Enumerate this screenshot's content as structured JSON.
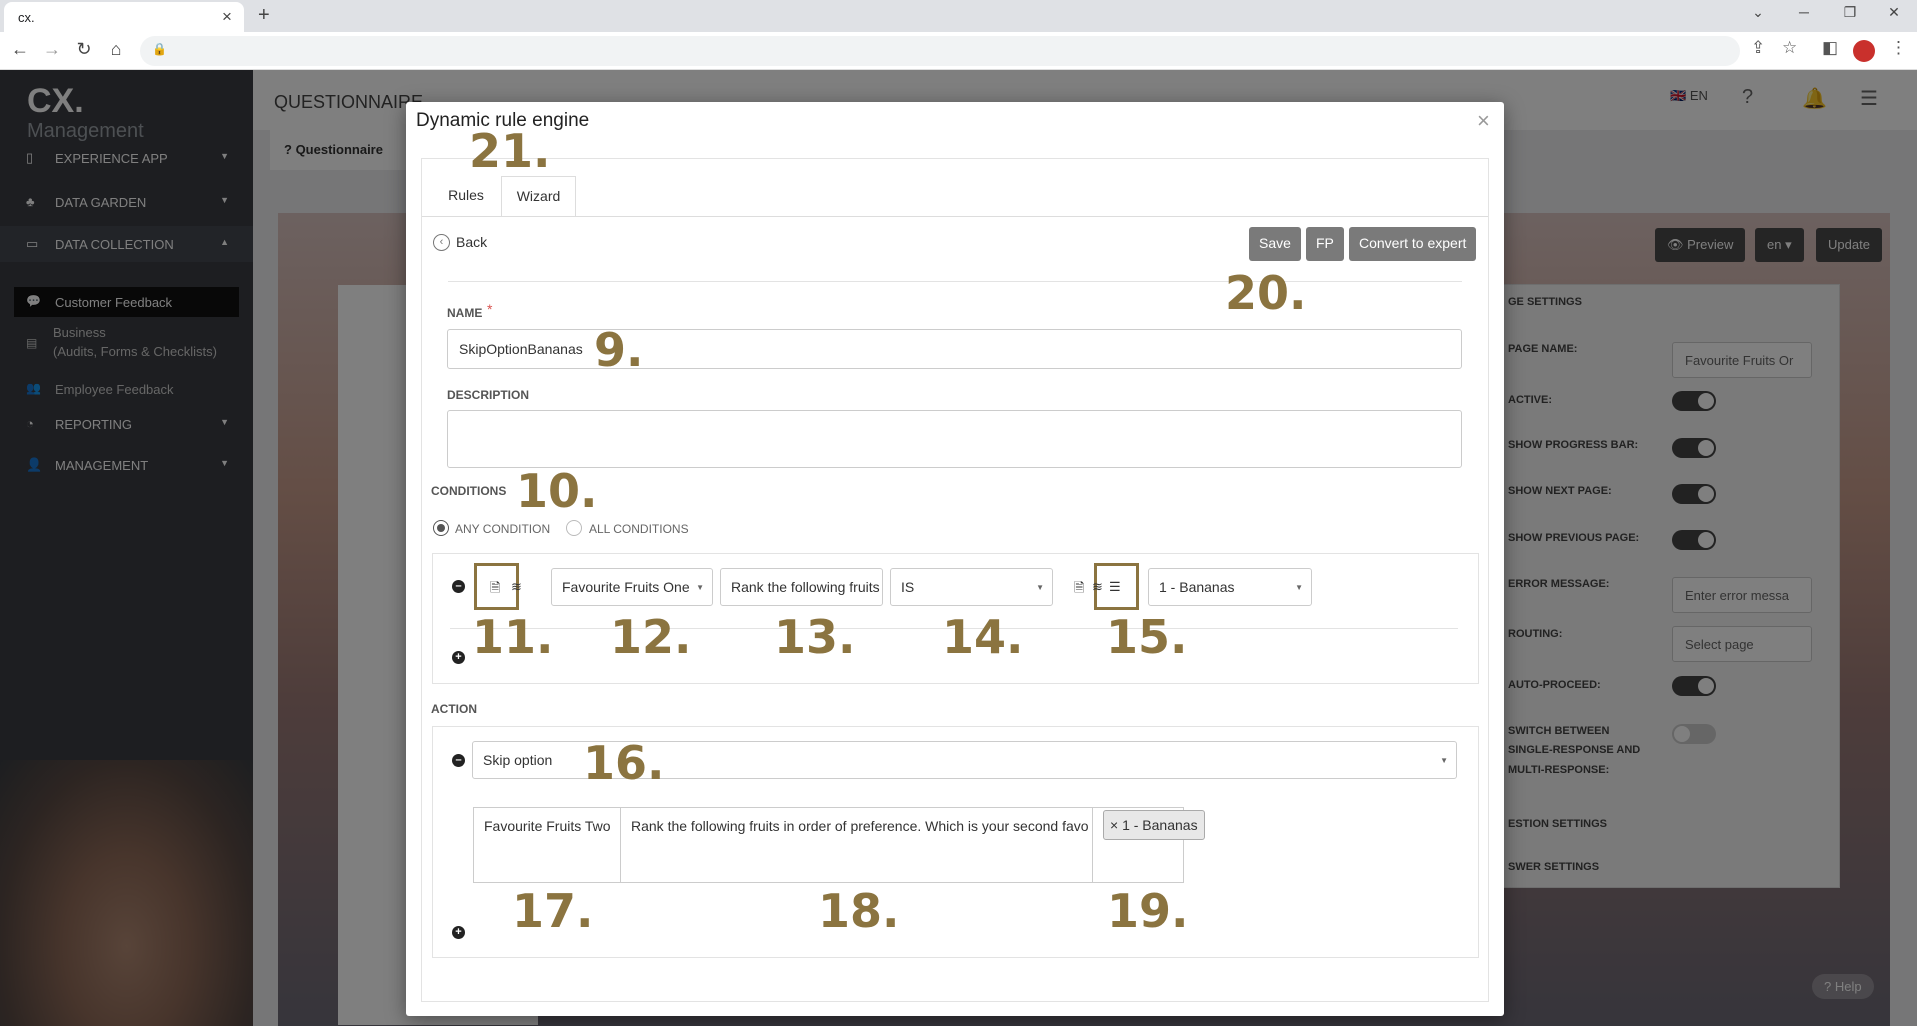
{
  "browser": {
    "tab_title": "cx.",
    "tab_close": "×",
    "new_tab": "+"
  },
  "app": {
    "logo": "CX.",
    "logo_sub": "Management",
    "page_title": "QUESTIONNAIRE",
    "language": "EN",
    "sidebar": [
      {
        "label": "EXPERIENCE APP",
        "icon": "phone-icon",
        "caret": "▼"
      },
      {
        "label": "DATA GARDEN",
        "icon": "plant-icon",
        "caret": "▼"
      },
      {
        "label": "DATA COLLECTION",
        "icon": "inbox-icon",
        "caret": "▲"
      },
      {
        "label": "Customer Feedback",
        "icon": "comments-icon"
      },
      {
        "label": "Business",
        "label2": "(Audits, Forms & Checklists)",
        "icon": "briefcase-icon"
      },
      {
        "label": "Employee Feedback",
        "icon": "users-icon"
      },
      {
        "label": "REPORTING",
        "icon": "chart-icon",
        "caret": "▼"
      },
      {
        "label": "MANAGEMENT",
        "icon": "user-icon",
        "caret": "▼"
      }
    ],
    "questionnaire_tab": "Questionnaire",
    "buttons": {
      "preview": "Preview",
      "lang": "en",
      "update": "Update"
    },
    "page_settings": {
      "title": "GE SETTINGS",
      "page_name_label": "PAGE NAME:",
      "page_name_value": "Favourite Fruits Or",
      "active_label": "ACTIVE:",
      "progress_label": "SHOW PROGRESS BAR:",
      "next_label": "SHOW NEXT PAGE:",
      "previous_label": "SHOW PREVIOUS PAGE:",
      "error_label": "ERROR MESSAGE:",
      "error_placeholder": "Enter error messa",
      "routing_label": "ROUTING:",
      "routing_value": "Select page",
      "auto_label": "AUTO-PROCEED:",
      "switch_label_1": "SWITCH BETWEEN",
      "switch_label_2": "SINGLE-RESPONSE AND",
      "switch_label_3": "MULTI-RESPONSE:",
      "question_settings": "ESTION SETTINGS",
      "answer_settings": "SWER SETTINGS"
    },
    "help": "Help"
  },
  "modal": {
    "title": "Dynamic rule engine",
    "close": "×",
    "tabs": [
      "Rules",
      "Wizard"
    ],
    "back": "Back",
    "save": "Save",
    "fp": "FP",
    "convert": "Convert to expert",
    "name_label": "NAME",
    "required_mark": "*",
    "name_value": "SkipOptionBananas",
    "description_label": "DESCRIPTION",
    "conditions_label": "CONDITIONS",
    "any_condition": "ANY CONDITION",
    "all_conditions": "ALL CONDITIONS",
    "condition": {
      "page": "Favourite Fruits One",
      "question": "Rank the following fruits",
      "operator": "IS",
      "value": "1 - Bananas"
    },
    "action_label": "ACTION",
    "action": {
      "type": "Skip option",
      "page": "Favourite Fruits Two",
      "question": "Rank the following fruits in order of preference. Which is your second favo",
      "chip": "1 - Bananas",
      "chip_remove": "×"
    }
  },
  "annotations": [
    "9.",
    "10.",
    "11.",
    "12.",
    "13.",
    "14.",
    "15.",
    "16.",
    "17.",
    "18.",
    "19.",
    "20.",
    "21."
  ]
}
